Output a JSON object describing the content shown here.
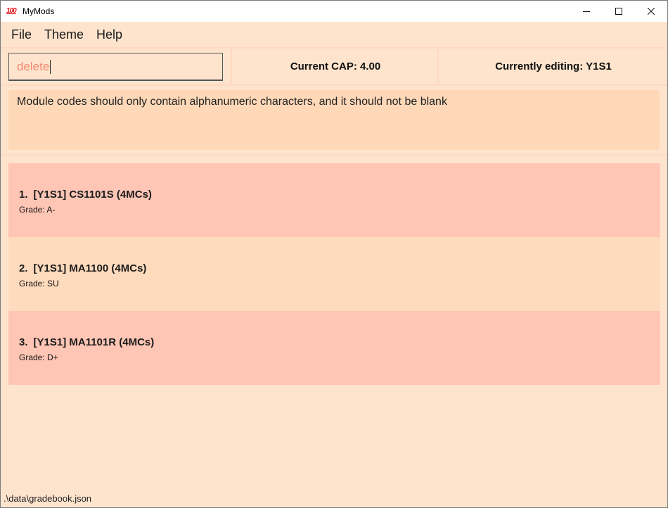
{
  "window": {
    "title": "MyMods",
    "icon": "hundred-points-icon",
    "icon_glyph": "100"
  },
  "menu": [
    "File",
    "Theme",
    "Help"
  ],
  "command": {
    "value": "delete"
  },
  "status_panels": {
    "cap": "Current CAP: 4.00",
    "editing": "Currently editing: Y1S1"
  },
  "result": {
    "message": "Module codes should only contain alphanumeric characters, and it should not be blank"
  },
  "modules": [
    {
      "index": "1.",
      "title": "[Y1S1] CS1101S (4MCs)",
      "grade": "Grade: A-",
      "color": "#ffc6b6"
    },
    {
      "index": "2.",
      "title": "[Y1S1] MA1100 (4MCs)",
      "grade": "Grade: SU",
      "color": "#ffdbbd"
    },
    {
      "index": "3.",
      "title": "[Y1S1] MA1101R (4MCs)",
      "grade": "Grade: D+",
      "color": "#ffc6b6"
    }
  ],
  "statusbar": {
    "path": ".\\data\\gradebook.json"
  },
  "colors": {
    "background": "#ffe4cd",
    "card_red": "#ffc6b6",
    "card_peach": "#ffdbbd",
    "command_text": "#f08a6e"
  }
}
